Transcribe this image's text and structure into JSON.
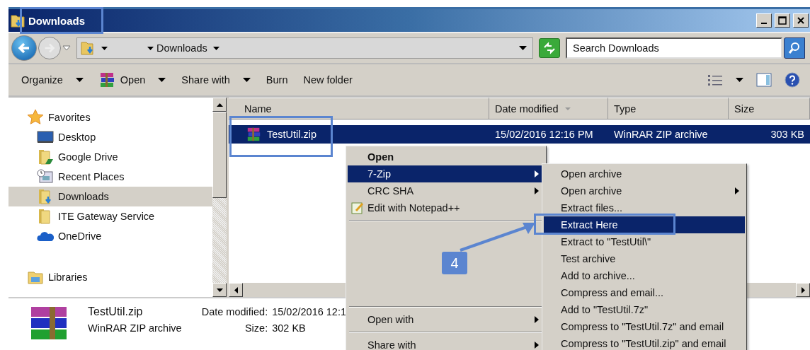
{
  "window": {
    "title": "Downloads"
  },
  "address": {
    "path": "Downloads"
  },
  "search": {
    "placeholder": "Search Downloads"
  },
  "toolbar": [
    {
      "label": "Organize",
      "dropdown": true,
      "icon": false
    },
    {
      "label": "Open",
      "dropdown": true,
      "icon": true
    },
    {
      "label": "Share with",
      "dropdown": true,
      "icon": false
    },
    {
      "label": "Burn",
      "dropdown": false,
      "icon": false
    },
    {
      "label": "New folder",
      "dropdown": false,
      "icon": false
    }
  ],
  "nav": [
    {
      "label": "Favorites",
      "selected": false,
      "children": [
        {
          "label": "Desktop",
          "selected": false
        },
        {
          "label": "Google Drive",
          "selected": false
        },
        {
          "label": "Recent Places",
          "selected": false
        },
        {
          "label": "Downloads",
          "selected": true
        },
        {
          "label": "ITE Gateway Service",
          "selected": false
        },
        {
          "label": "OneDrive",
          "selected": false
        }
      ]
    },
    {
      "label": "Libraries",
      "selected": false
    }
  ],
  "columns": [
    {
      "label": "Name",
      "sorted": false
    },
    {
      "label": "Date modified",
      "sorted": true
    },
    {
      "label": "Type",
      "sorted": false
    },
    {
      "label": "Size",
      "sorted": false
    }
  ],
  "rows": [
    {
      "name": "TestUtil.zip",
      "date": "15/02/2016 12:16 PM",
      "type": "WinRAR ZIP archive",
      "size": "303 KB",
      "selected": true
    }
  ],
  "details": {
    "name": "TestUtil.zip",
    "type": "WinRAR ZIP archive",
    "date_label": "Date modified:",
    "date_value": "15/02/2016 12:1",
    "size_label": "Size:",
    "size_value": "302 KB"
  },
  "context_menu": [
    {
      "kind": "item",
      "label": "Open",
      "bold": true,
      "selected": false,
      "submenu": false
    },
    {
      "kind": "item",
      "label": "7-Zip",
      "bold": false,
      "selected": true,
      "submenu": true
    },
    {
      "kind": "item",
      "label": "CRC SHA",
      "bold": false,
      "selected": false,
      "submenu": true
    },
    {
      "kind": "item",
      "label": "Edit with Notepad++",
      "bold": false,
      "selected": false,
      "submenu": false
    },
    {
      "kind": "separator"
    },
    {
      "kind": "blank"
    },
    {
      "kind": "separator"
    },
    {
      "kind": "item",
      "label": "Open with",
      "bold": false,
      "selected": false,
      "submenu": true
    },
    {
      "kind": "separator"
    },
    {
      "kind": "item",
      "label": "Share with",
      "bold": false,
      "selected": false,
      "submenu": true
    }
  ],
  "submenu": [
    {
      "label": "Open archive",
      "selected": false,
      "submenu": false
    },
    {
      "label": "Open archive",
      "selected": false,
      "submenu": true
    },
    {
      "label": "Extract files...",
      "selected": false,
      "submenu": false
    },
    {
      "label": "Extract Here",
      "selected": true,
      "submenu": false
    },
    {
      "label": "Extract to \"TestUtil\\\"",
      "selected": false,
      "submenu": false
    },
    {
      "label": "Test archive",
      "selected": false,
      "submenu": false
    },
    {
      "label": "Add to archive...",
      "selected": false,
      "submenu": false
    },
    {
      "label": "Compress and email...",
      "selected": false,
      "submenu": false
    },
    {
      "label": "Add to \"TestUtil.7z\"",
      "selected": false,
      "submenu": false
    },
    {
      "label": "Compress to \"TestUtil.7z\" and email",
      "selected": false,
      "submenu": false
    },
    {
      "label": "Compress to \"TestUtil.zip\" and email",
      "selected": false,
      "submenu": false
    }
  ],
  "step": {
    "label": "4"
  }
}
